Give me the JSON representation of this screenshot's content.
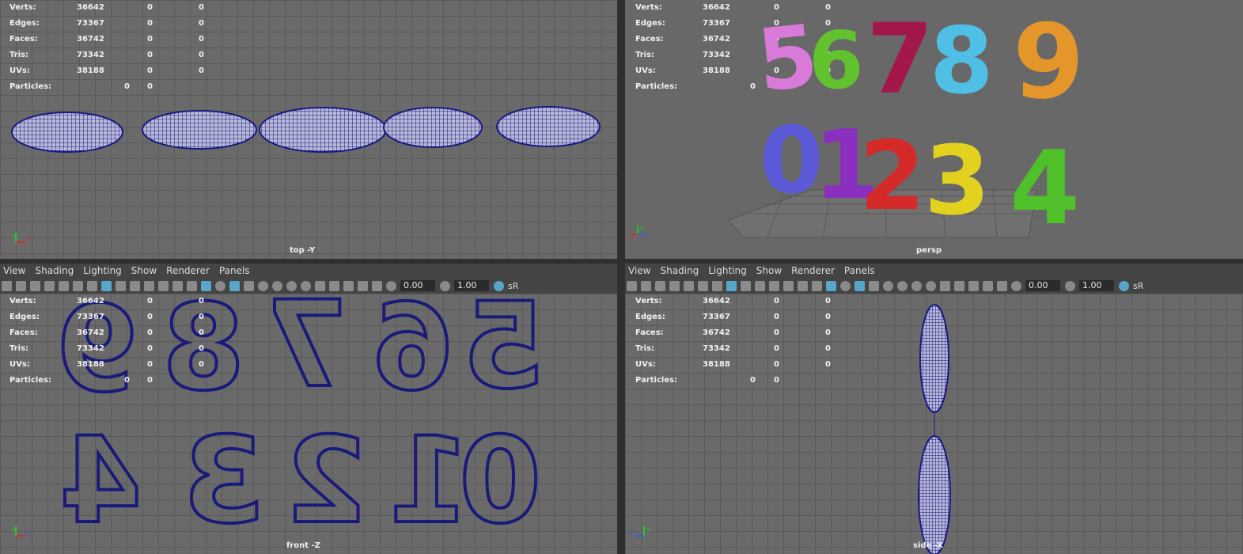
{
  "stats": {
    "labels": [
      "Verts:",
      "Edges:",
      "Faces:",
      "Tris:",
      "UVs:",
      "Particles:"
    ],
    "values": [
      [
        "36642",
        "0",
        "0"
      ],
      [
        "73367",
        "0",
        "0"
      ],
      [
        "36742",
        "0",
        "0"
      ],
      [
        "73342",
        "0",
        "0"
      ],
      [
        "38188",
        "0",
        "0"
      ],
      [
        "0",
        "0"
      ]
    ]
  },
  "viewports": {
    "top": {
      "label": "top -Y"
    },
    "persp": {
      "label": "persp"
    },
    "front": {
      "label": "front -Z"
    },
    "side": {
      "label": "side -X"
    }
  },
  "menu": [
    "View",
    "Shading",
    "Lighting",
    "Show",
    "Renderer",
    "Panels"
  ],
  "toolbar_fields": {
    "a": "0.00",
    "b": "1.00",
    "tail": "sR"
  },
  "persp_digits": {
    "row1": [
      "5",
      "6",
      "7",
      "8",
      "9"
    ],
    "row2": [
      "0",
      "1",
      "2",
      "3",
      "4"
    ],
    "colors": {
      "5": "#d77ad8",
      "6": "#62c22e",
      "7": "#a3174c",
      "8": "#4fbfe6",
      "9": "#e5962b",
      "0": "#5b5bd9",
      "1": "#8a2fbf",
      "2": "#d52a2a",
      "3": "#e2d21f",
      "4": "#4fbf2a"
    }
  },
  "front_digits": {
    "row1": [
      "9",
      "8",
      "7",
      "6",
      "5"
    ],
    "row2": [
      "4",
      "3",
      "2",
      "1",
      "0"
    ]
  },
  "axis_labels": {
    "x": "x",
    "y": "y",
    "z": "z"
  }
}
